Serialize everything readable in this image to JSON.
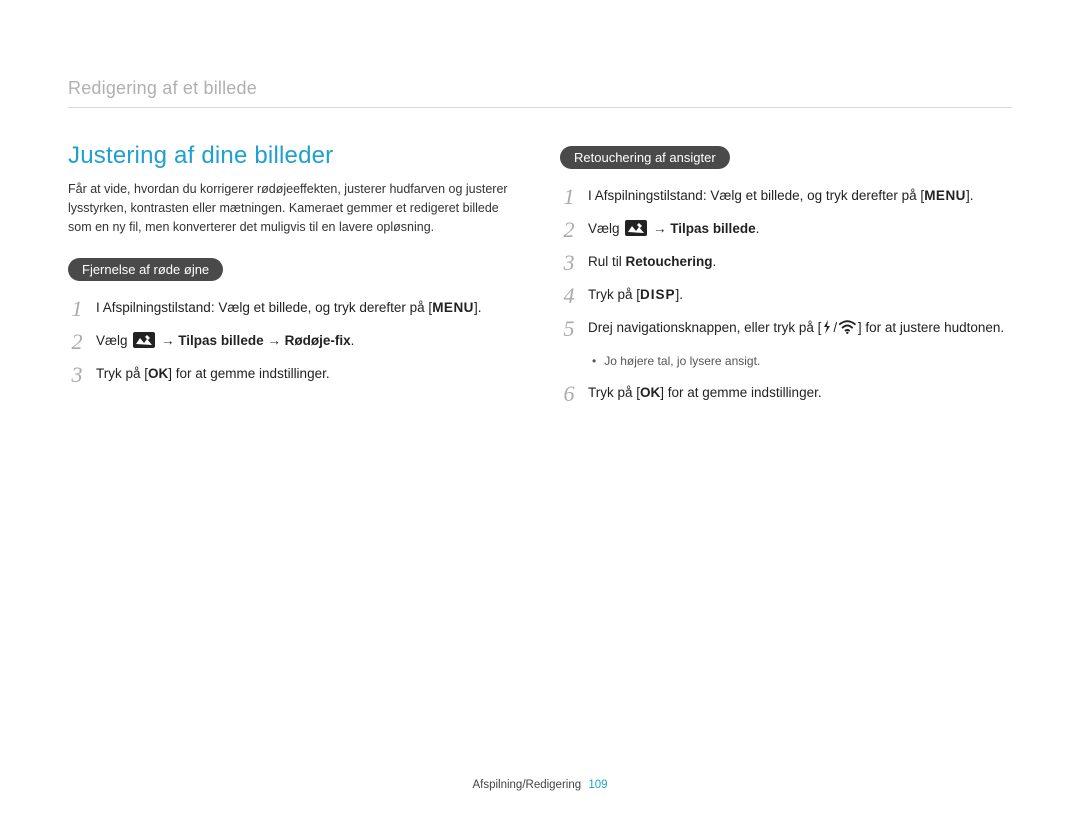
{
  "header": {
    "title": "Redigering af et billede"
  },
  "left": {
    "section_title": "Justering af dine billeder",
    "intro": "Får at vide, hvordan du korrigerer rødøjeeffekten, justerer hudfarven og justerer lysstyrken, kontrasten eller mætningen. Kameraet gemmer et redigeret billede som en ny fil, men konverterer det muligvis til en lavere opløsning.",
    "pill": "Fjernelse af røde øjne",
    "steps": {
      "s1_a": "I Afspilningstilstand: Vælg et billede, og tryk derefter på [",
      "s1_menu": "MENU",
      "s1_b": "].",
      "s2_a": "Vælg ",
      "s2_b": " → ",
      "s2_bold1": "Tilpas billede",
      "s2_c": " → ",
      "s2_bold2": "Rødøje-fix",
      "s2_d": ".",
      "s3_a": "Tryk på [",
      "s3_ok": "OK",
      "s3_b": "] for at gemme indstillinger."
    }
  },
  "right": {
    "pill": "Retouchering af ansigter",
    "steps": {
      "s1_a": "I Afspilningstilstand: Vælg et billede, og tryk derefter på [",
      "s1_menu": "MENU",
      "s1_b": "].",
      "s2_a": "Vælg ",
      "s2_b": " → ",
      "s2_bold": "Tilpas billede",
      "s2_c": ".",
      "s3_a": "Rul til ",
      "s3_bold": "Retouchering",
      "s3_b": ".",
      "s4_a": "Tryk på [",
      "s4_disp": "DISP",
      "s4_b": "].",
      "s5_a": "Drej navigationsknappen, eller tryk på [",
      "s5_b": "/",
      "s5_c": "] for at justere hudtonen.",
      "note": "Jo højere tal, jo lysere ansigt.",
      "s6_a": "Tryk på [",
      "s6_ok": "OK",
      "s6_b": "] for at gemme indstillinger."
    }
  },
  "footer": {
    "section": "Afspilning/Redigering",
    "page": "109"
  },
  "nums": {
    "n1": "1",
    "n2": "2",
    "n3": "3",
    "n4": "4",
    "n5": "5",
    "n6": "6"
  }
}
